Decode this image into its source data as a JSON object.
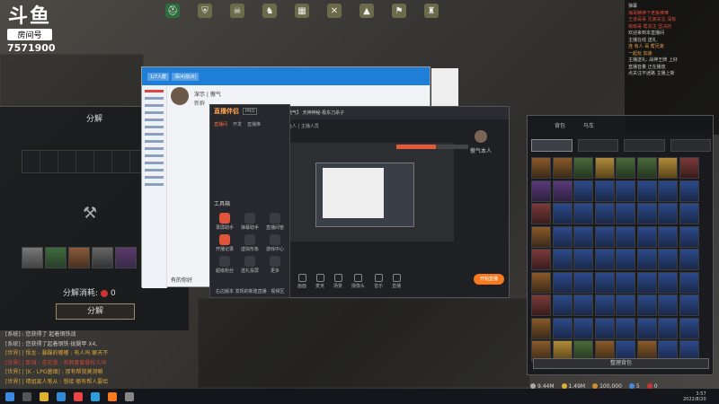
{
  "logo": {
    "brand": "斗鱼",
    "room_label": "房间号",
    "room_number": "7571900"
  },
  "hud": {
    "icons": [
      "helmet-icon",
      "shield-icon",
      "skull-icon",
      "horse-icon",
      "map-icon",
      "crossed-axes-icon",
      "tent-icon",
      "flag-icon",
      "castle-icon"
    ]
  },
  "decompose": {
    "title": "分解",
    "cost_label": "分解消耗:",
    "cost_value": "0",
    "button_label": "分解"
  },
  "chat_log": [
    {
      "type": "sys",
      "text": "[系统] : 您获得了 起着钢铁战"
    },
    {
      "type": "sys",
      "text": "[系统] : 您获得了起着钢铁·拢腿甲 X4,"
    },
    {
      "type": "world",
      "text": "[世界] | 悟龙 - 暴躁的嘟嘟 : 有人吗 聊天不"
    },
    {
      "type": "world2",
      "text": "[世界] | 距渊 - 花花草 : 有两套套餐权人吗"
    },
    {
      "type": "world",
      "text": "[世界] | [K - LPG菌锢] : 那有帮我莫测嘛"
    },
    {
      "type": "world",
      "text": "[世界] | 晴姐离人笔从 : 想接 哪有帮人要给"
    }
  ],
  "qq_window": {
    "tab1": "1/7人群",
    "tab2": "深(4)前(6)",
    "contact_name": "深示 | 傲气",
    "contact_sub": "新群",
    "footer": "有的你好"
  },
  "live_companion": {
    "brand": "直播伴侣",
    "badge": "PRO",
    "tabs": [
      "直播间",
      "开发",
      "直播推"
    ],
    "section_tools": "工具箱",
    "tools": [
      "录屏助手",
      "弹幕助手",
      "直播间管",
      "开播记录",
      "虚拟形象",
      "游戏中心",
      "超级粉丝",
      "送礼投屏",
      "更多"
    ]
  },
  "stream_window": {
    "title": "【傲气】 天神神秘·极东刀杀子",
    "subtitle": "鲨鱼人 | 主播人员",
    "host_name": "傲气本人",
    "progress_percent": 55,
    "controls": [
      "画面",
      "麦克",
      "场景",
      "摄像头",
      "音乐",
      "直播"
    ],
    "start_button": "开始直播",
    "note": "右边版本 发现的新建直播 · 视频区"
  },
  "right_chat": [
    {
      "c": "",
      "t": "弹幕"
    },
    {
      "c": "red",
      "t": "海哥精神下老板棒棒"
    },
    {
      "c": "red",
      "t": "王道哥哥 兄弟关注 深有"
    },
    {
      "c": "red",
      "t": "呦呦哥 帮关注 坚决的"
    },
    {
      "c": "",
      "t": "欢迎来到本直播间"
    },
    {
      "c": "",
      "t": "主播在线 送礼"
    },
    {
      "c": "org",
      "t": "连 有人 哥 帮兄弟"
    },
    {
      "c": "org",
      "t": "一起玩 加速"
    },
    {
      "c": "",
      "t": "主播送礼: 战神王牌 上好"
    },
    {
      "c": "",
      "t": "直播音量 正在播放"
    },
    {
      "c": "",
      "t": "点关注不迷路 主播上新"
    }
  ],
  "backpack": {
    "tabs": [
      "背包",
      "马车"
    ],
    "bottom_button": "整理背包"
  },
  "stats": {
    "silver": "9.44M",
    "gold": "1.49M",
    "coin": "100,000",
    "gem": "5",
    "other": "0"
  },
  "clock": {
    "time": "3:57",
    "date": "2022/8/20"
  }
}
